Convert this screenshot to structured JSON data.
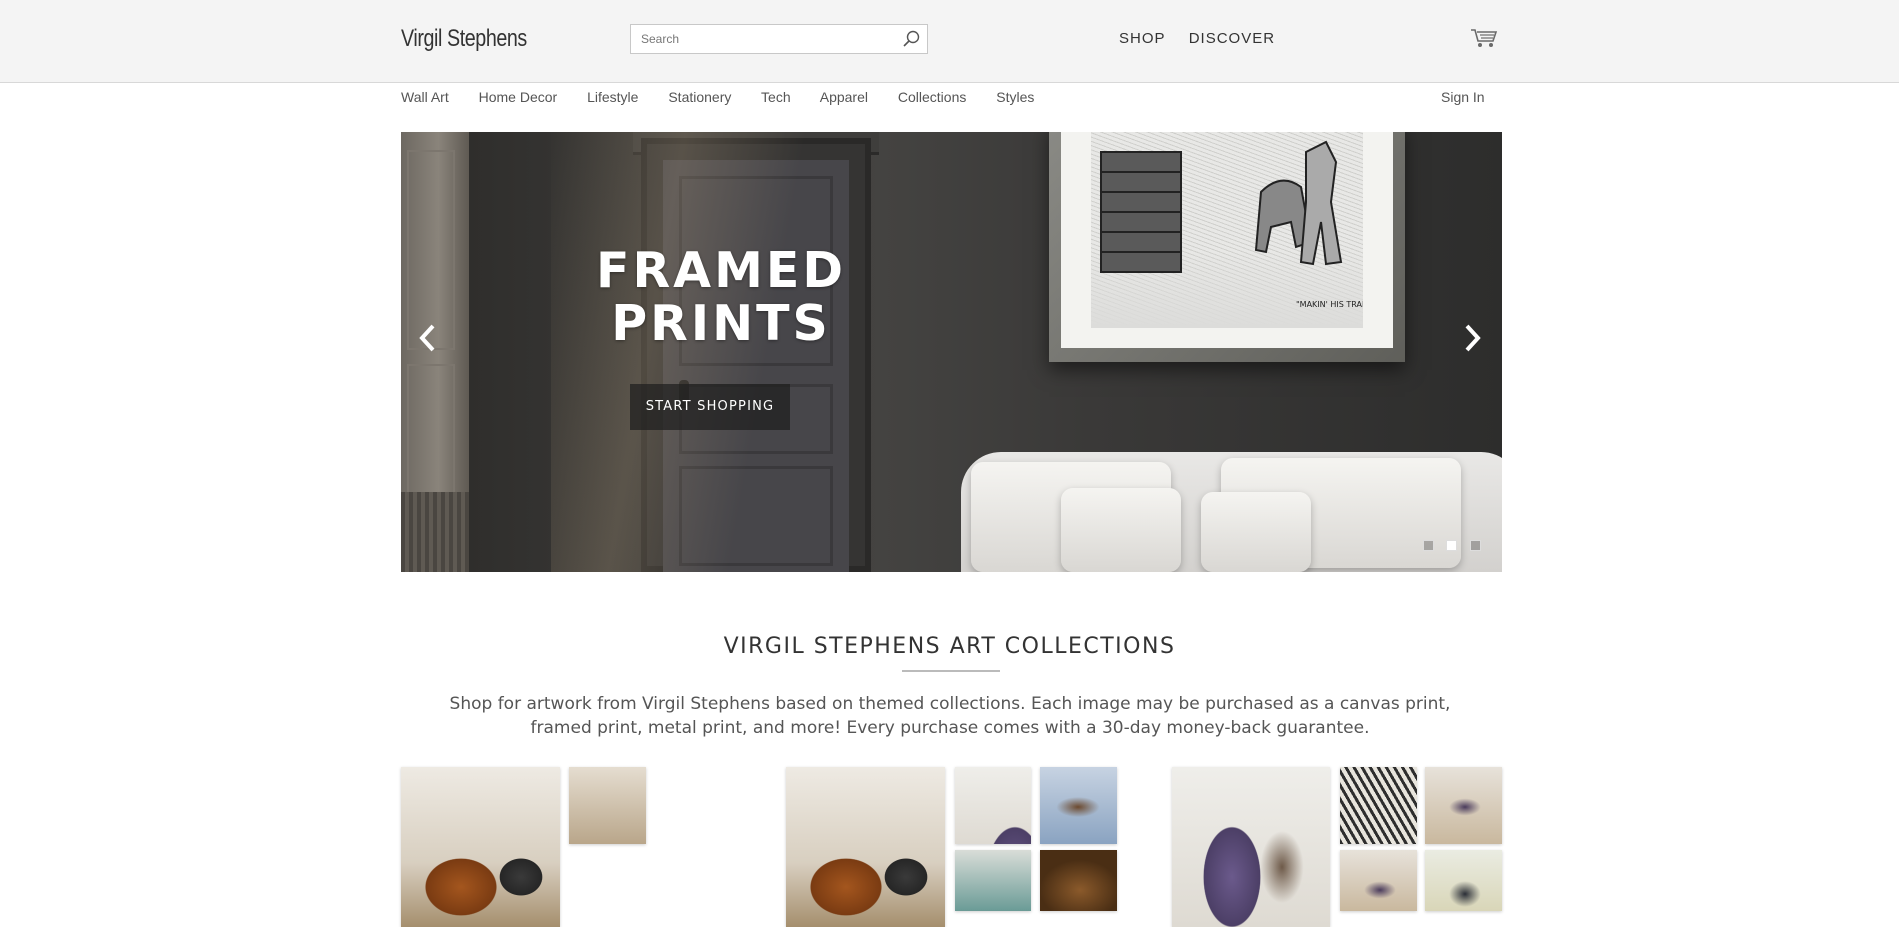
{
  "header": {
    "brand": "Virgil Stephens",
    "search_placeholder": "Search",
    "nav": [
      "SHOP",
      "DISCOVER"
    ],
    "icons": {
      "search": "search-icon",
      "cart": "cart-icon"
    }
  },
  "categories": [
    "Wall Art",
    "Home Decor",
    "Lifestyle",
    "Stationery",
    "Tech",
    "Apparel",
    "Collections",
    "Styles"
  ],
  "account": {
    "sign_in": "Sign In"
  },
  "hero": {
    "title_line1": "FRAMED",
    "title_line2": "PRINTS",
    "cta": "START SHOPPING",
    "slides": 3,
    "active_slide": 2,
    "artwork_caption": "\"MAKIN' HIS TRAIL\""
  },
  "collections": {
    "title": "VIRGIL STEPHENS ART COLLECTIONS",
    "description": "Shop for artwork from Virgil Stephens based on themed collections. Each image may be purchased as a canvas print, framed print, metal print, and more! Every purchase comes with a 30-day money-back guarantee."
  },
  "colors": {
    "header_bg": "#f4f4f4",
    "text": "#333333",
    "muted": "#555555",
    "cta_bg": "#1e1e1e"
  }
}
